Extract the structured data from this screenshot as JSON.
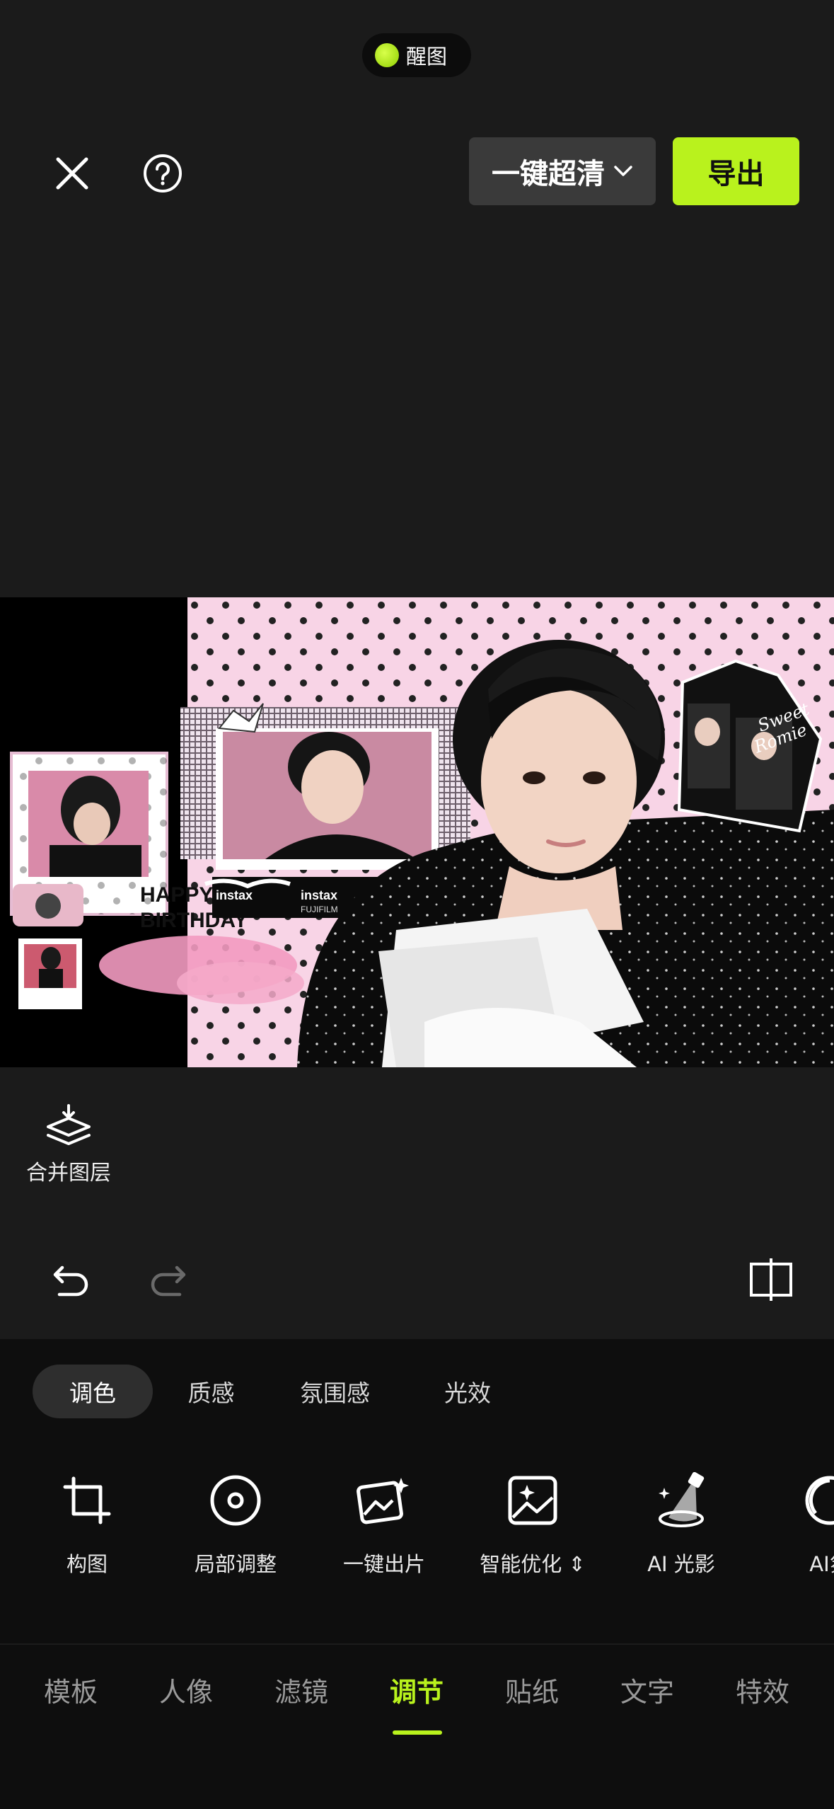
{
  "status_pill": {
    "label": "醒图"
  },
  "header": {
    "close_icon": "close-icon",
    "help_icon": "help-icon",
    "quality_button": "一键超清",
    "export_button": "导出"
  },
  "canvas": {
    "photo_texts": {
      "instax": "instax",
      "fujifilm": "FUJIFILM",
      "sweet": "Sweet",
      "romie": "Romie",
      "happy": "HAPPY",
      "birthday": "BIRTHDAY"
    }
  },
  "merge_layers": {
    "label": "合并图层"
  },
  "colors": {
    "accent": "#b9f21d",
    "panel": "#0e0e0e",
    "background": "#1b1b1b"
  },
  "sub_tabs": [
    {
      "label": "调色",
      "active": true
    },
    {
      "label": "质感"
    },
    {
      "label": "氛围感"
    },
    {
      "label": "光效"
    }
  ],
  "tools": [
    {
      "label": "构图",
      "icon": "crop-icon"
    },
    {
      "label": "局部调整",
      "icon": "target-icon"
    },
    {
      "label": "一键出片",
      "icon": "magic-photo-icon"
    },
    {
      "label": "智能优化",
      "icon": "sparkle-photo-icon"
    },
    {
      "label": "AI 光影",
      "icon": "spotlight-icon"
    },
    {
      "label": "AI氛",
      "icon": "ai-atmosphere-icon"
    }
  ],
  "main_tabs": [
    {
      "label": "模板"
    },
    {
      "label": "人像"
    },
    {
      "label": "滤镜"
    },
    {
      "label": "调节",
      "active": true
    },
    {
      "label": "贴纸"
    },
    {
      "label": "文字"
    },
    {
      "label": "特效"
    }
  ]
}
